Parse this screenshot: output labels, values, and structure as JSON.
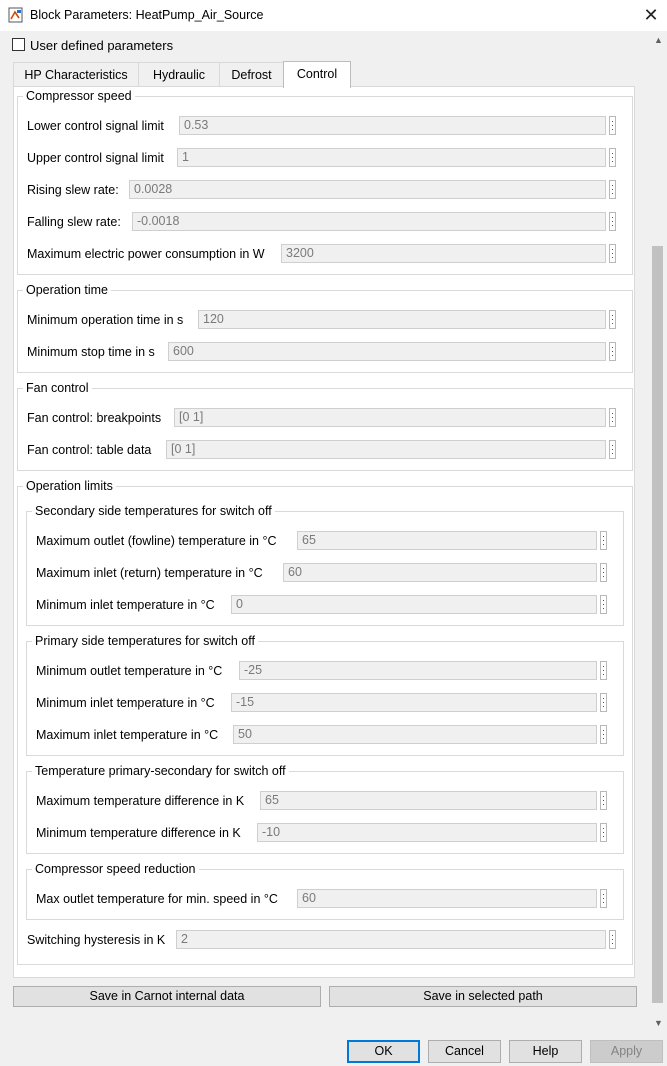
{
  "window": {
    "title": "Block Parameters: HeatPump_Air_Source",
    "close_glyph": "✕",
    "icon": "simulink-block-icon"
  },
  "user_defined": {
    "label": "User defined parameters",
    "checked": false
  },
  "tabs": [
    {
      "label": "HP Characteristics",
      "active": false
    },
    {
      "label": "Hydraulic",
      "active": false
    },
    {
      "label": "Defrost",
      "active": false
    },
    {
      "label": "Control",
      "active": true
    }
  ],
  "groups": {
    "compressor_speed": {
      "title": "Compressor speed",
      "fields": [
        {
          "label": "Lower control signal limit",
          "value": "0.53"
        },
        {
          "label": "Upper control signal limit",
          "value": "1"
        },
        {
          "label": "Rising slew rate:",
          "value": "0.0028"
        },
        {
          "label": "Falling slew rate:",
          "value": "-0.0018"
        },
        {
          "label": "Maximum electric power consumption in W",
          "value": "3200"
        }
      ]
    },
    "operation_time": {
      "title": "Operation time",
      "fields": [
        {
          "label": "Minimum operation time in s",
          "value": "120"
        },
        {
          "label": "Minimum stop time in s",
          "value": "600"
        }
      ]
    },
    "fan_control": {
      "title": "Fan control",
      "fields": [
        {
          "label": "Fan control: breakpoints",
          "value": "[0 1]"
        },
        {
          "label": "Fan control: table data",
          "value": "[0 1]"
        }
      ]
    },
    "operation_limits": {
      "title": "Operation limits",
      "secondary": {
        "title": "Secondary side temperatures  for switch off",
        "fields": [
          {
            "label": "Maximum outlet (fowline) temperature in °C",
            "value": "65"
          },
          {
            "label": "Maximum inlet (return) temperature in °C",
            "value": "60"
          },
          {
            "label": "Minimum inlet temperature in °C",
            "value": "0"
          }
        ]
      },
      "primary": {
        "title": "Primary side temperatures  for switch off",
        "fields": [
          {
            "label": "Minimum outlet temperature in °C",
            "value": "-25"
          },
          {
            "label": "Minimum inlet temperature in °C",
            "value": "-15"
          },
          {
            "label": "Maximum inlet temperature in °C",
            "value": "50"
          }
        ]
      },
      "primary_secondary": {
        "title": "Temperature primary-secondary  for switch off",
        "fields": [
          {
            "label": "Maximum temperature difference in K",
            "value": "65"
          },
          {
            "label": "Minimum temperature difference in K",
            "value": "-10"
          }
        ]
      },
      "speed_reduction": {
        "title": "Compressor speed reduction",
        "fields": [
          {
            "label": "Max outlet temperature for min. speed in °C",
            "value": "60"
          }
        ]
      },
      "hysteresis": {
        "label": "Switching hysteresis in K",
        "value": "2"
      }
    }
  },
  "save_buttons": {
    "carnot": "Save in Carnot internal data",
    "selected": "Save in selected path"
  },
  "buttons": {
    "ok": "OK",
    "cancel": "Cancel",
    "help": "Help",
    "apply": "Apply"
  },
  "scrollbar": {
    "up": "▲",
    "down": "▼"
  },
  "colors": {
    "default_button_border": "#0078d7",
    "panel_bg": "#ffffff",
    "dialog_bg": "#f0f0f0"
  }
}
